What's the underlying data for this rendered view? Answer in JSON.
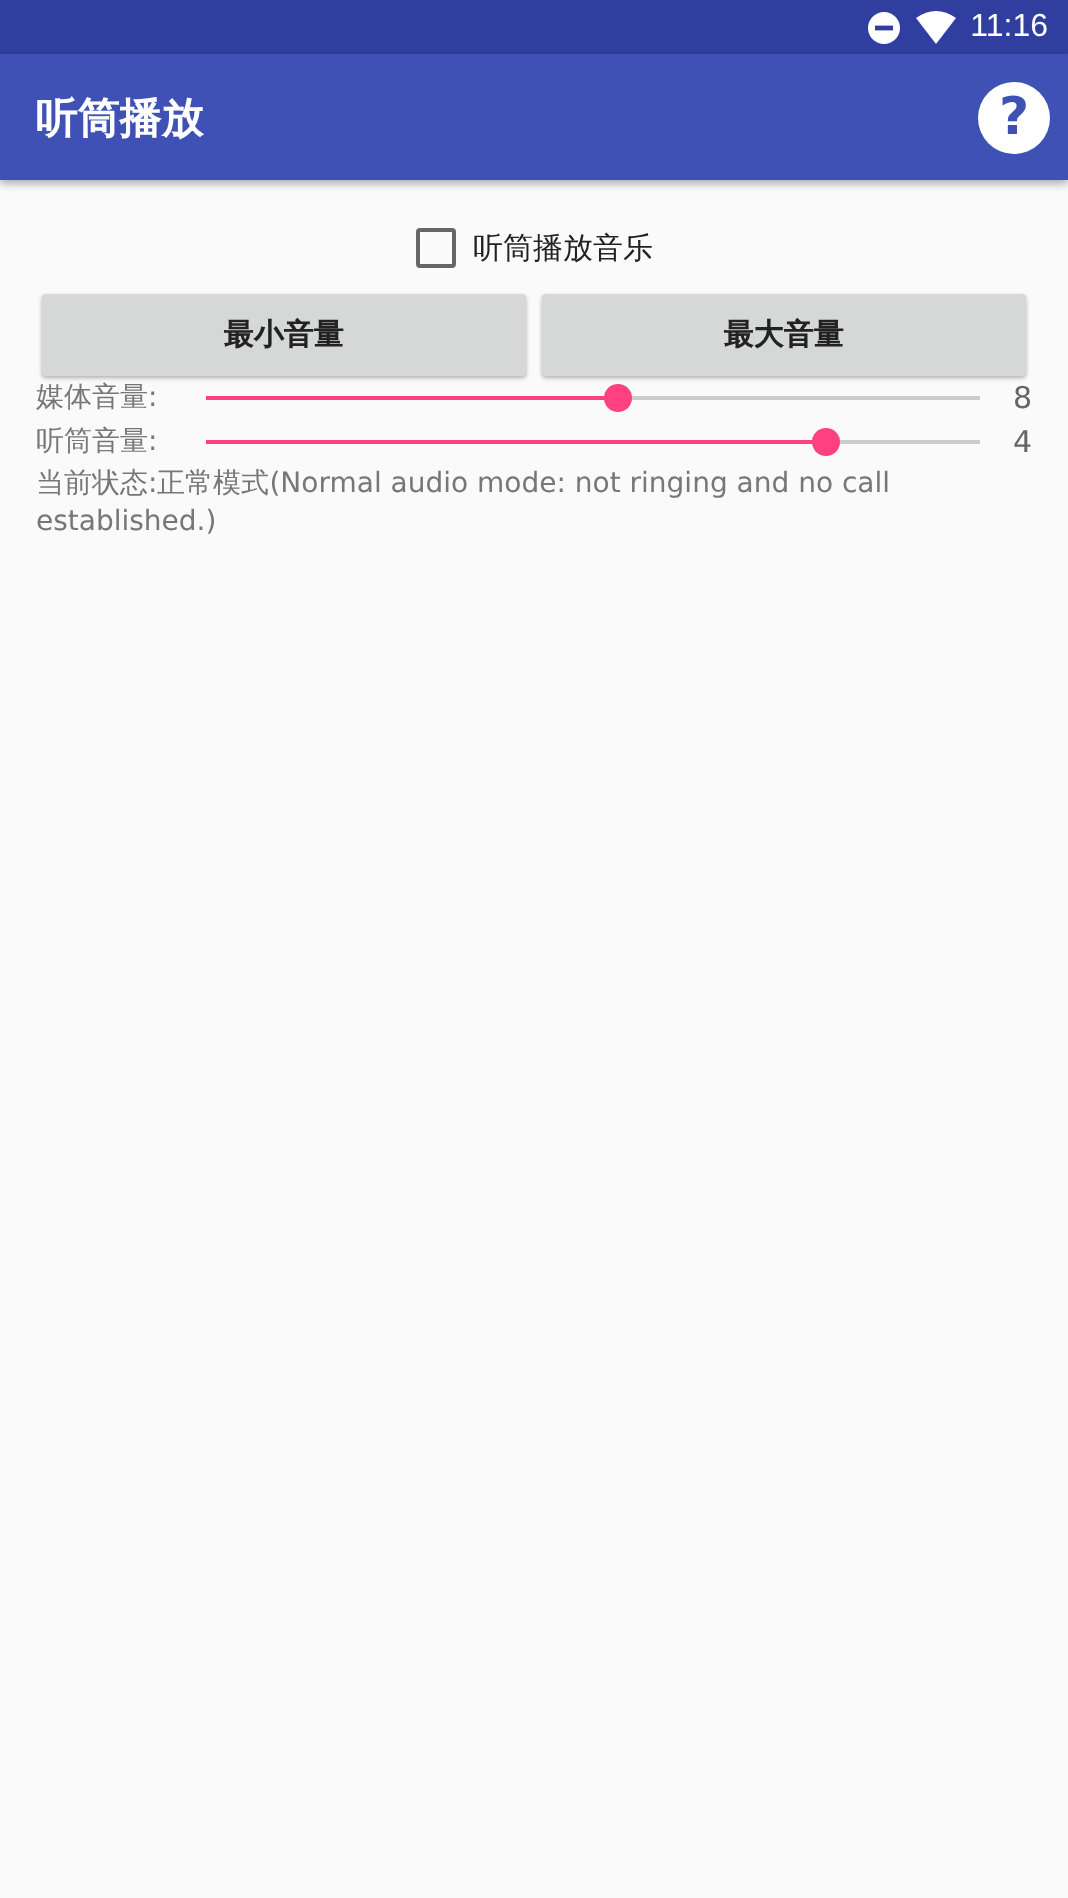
{
  "status_bar": {
    "time": "11:16"
  },
  "app_bar": {
    "title": "听筒播放",
    "help_button": "?"
  },
  "checkbox": {
    "label": "听筒播放音乐",
    "checked": false
  },
  "buttons": [
    "最小音量",
    "最大音量"
  ],
  "sliders": [
    {
      "label": "媒体音量:",
      "level": 0.533,
      "reading": "8"
    },
    {
      "label": "听筒音量:",
      "level": 0.8,
      "reading": "4"
    }
  ],
  "status_text": "当前状态:正常模式(Normal audio mode: not ringing and no call established.)"
}
